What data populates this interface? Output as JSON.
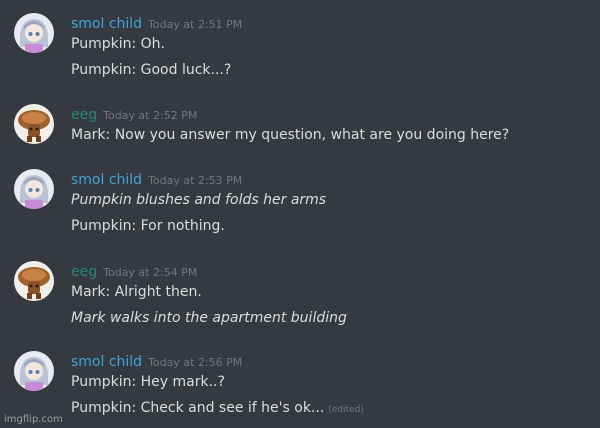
{
  "messages": [
    {
      "username": "smol child",
      "name_color": "#3ba6dc",
      "timestamp": "Today at 2:51 PM",
      "avatar_icon": "anime-girl-avatar",
      "lines": [
        {
          "text": "Pumpkin: Oh.",
          "italic": false
        },
        {
          "text": "Pumpkin: Good luck...?",
          "italic": false
        }
      ]
    },
    {
      "username": "eeg",
      "name_color": "#1f8b6f",
      "timestamp": "Today at 2:52 PM",
      "avatar_icon": "mushroom-avatar",
      "lines": [
        {
          "text": "Mark: Now you answer my question, what are you doing here?",
          "italic": false
        }
      ]
    },
    {
      "username": "smol child",
      "name_color": "#3ba6dc",
      "timestamp": "Today at 2:53 PM",
      "avatar_icon": "anime-girl-avatar",
      "lines": [
        {
          "text": "Pumpkin blushes and folds her arms",
          "italic": true
        },
        {
          "text": "Pumpkin: For nothing.",
          "italic": false
        }
      ]
    },
    {
      "username": "eeg",
      "name_color": "#1f8b6f",
      "timestamp": "Today at 2:54 PM",
      "avatar_icon": "mushroom-avatar",
      "lines": [
        {
          "text": "Mark: Alright then.",
          "italic": false
        },
        {
          "text": "Mark walks into the apartment building",
          "italic": true
        }
      ]
    },
    {
      "username": "smol child",
      "name_color": "#3ba6dc",
      "timestamp": "Today at 2:56 PM",
      "avatar_icon": "anime-girl-avatar",
      "lines": [
        {
          "text": "Pumpkin: Hey mark..?",
          "italic": false
        },
        {
          "text": "Pumpkin: Check and see if he's ok...",
          "italic": false,
          "edited": "(edited)"
        }
      ]
    }
  ],
  "watermark": "imgflip.com",
  "colors": {
    "background": "#36393f",
    "text": "#dcddde",
    "muted": "#72767d"
  }
}
